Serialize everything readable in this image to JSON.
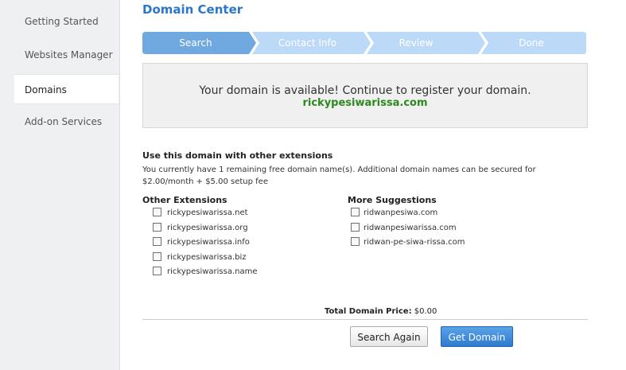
{
  "sidebar": {
    "items": [
      {
        "label": "Getting Started"
      },
      {
        "label": "Websites Manager"
      },
      {
        "label": "Domains"
      },
      {
        "label": "Add-on Services"
      }
    ]
  },
  "main": {
    "title": "Domain Center",
    "steps": [
      "Search",
      "Contact Info",
      "Review",
      "Done"
    ],
    "result": {
      "message": "Your domain is available! Continue to register your domain.",
      "domain": "rickypesiwarissa.com"
    },
    "extensions": {
      "heading": "Use this domain with other extensions",
      "description": "You currently have 1 remaining free domain name(s). Additional domain names can be secured for $2.00/month + $5.00 setup fee",
      "other_title": "Other Extensions",
      "other": [
        "rickypesiwarissa.net",
        "rickypesiwarissa.org",
        "rickypesiwarissa.info",
        "rickypesiwarissa.biz",
        "rickypesiwarissa.name"
      ],
      "suggest_title": "More Suggestions",
      "suggestions": [
        "ridwanpesiwa.com",
        "ridwanpesiwarissa.com",
        "ridwan-pe-siwa-rissa.com"
      ]
    },
    "total": {
      "label": "Total Domain Price:",
      "value": "$0.00"
    },
    "buttons": {
      "search_again": "Search Again",
      "get_domain": "Get Domain"
    },
    "colors": {
      "accent": "#2a77c9",
      "active_step": "#6fa9df",
      "inactive_step": "#bcdaf7",
      "available": "#2b8a1f"
    }
  }
}
